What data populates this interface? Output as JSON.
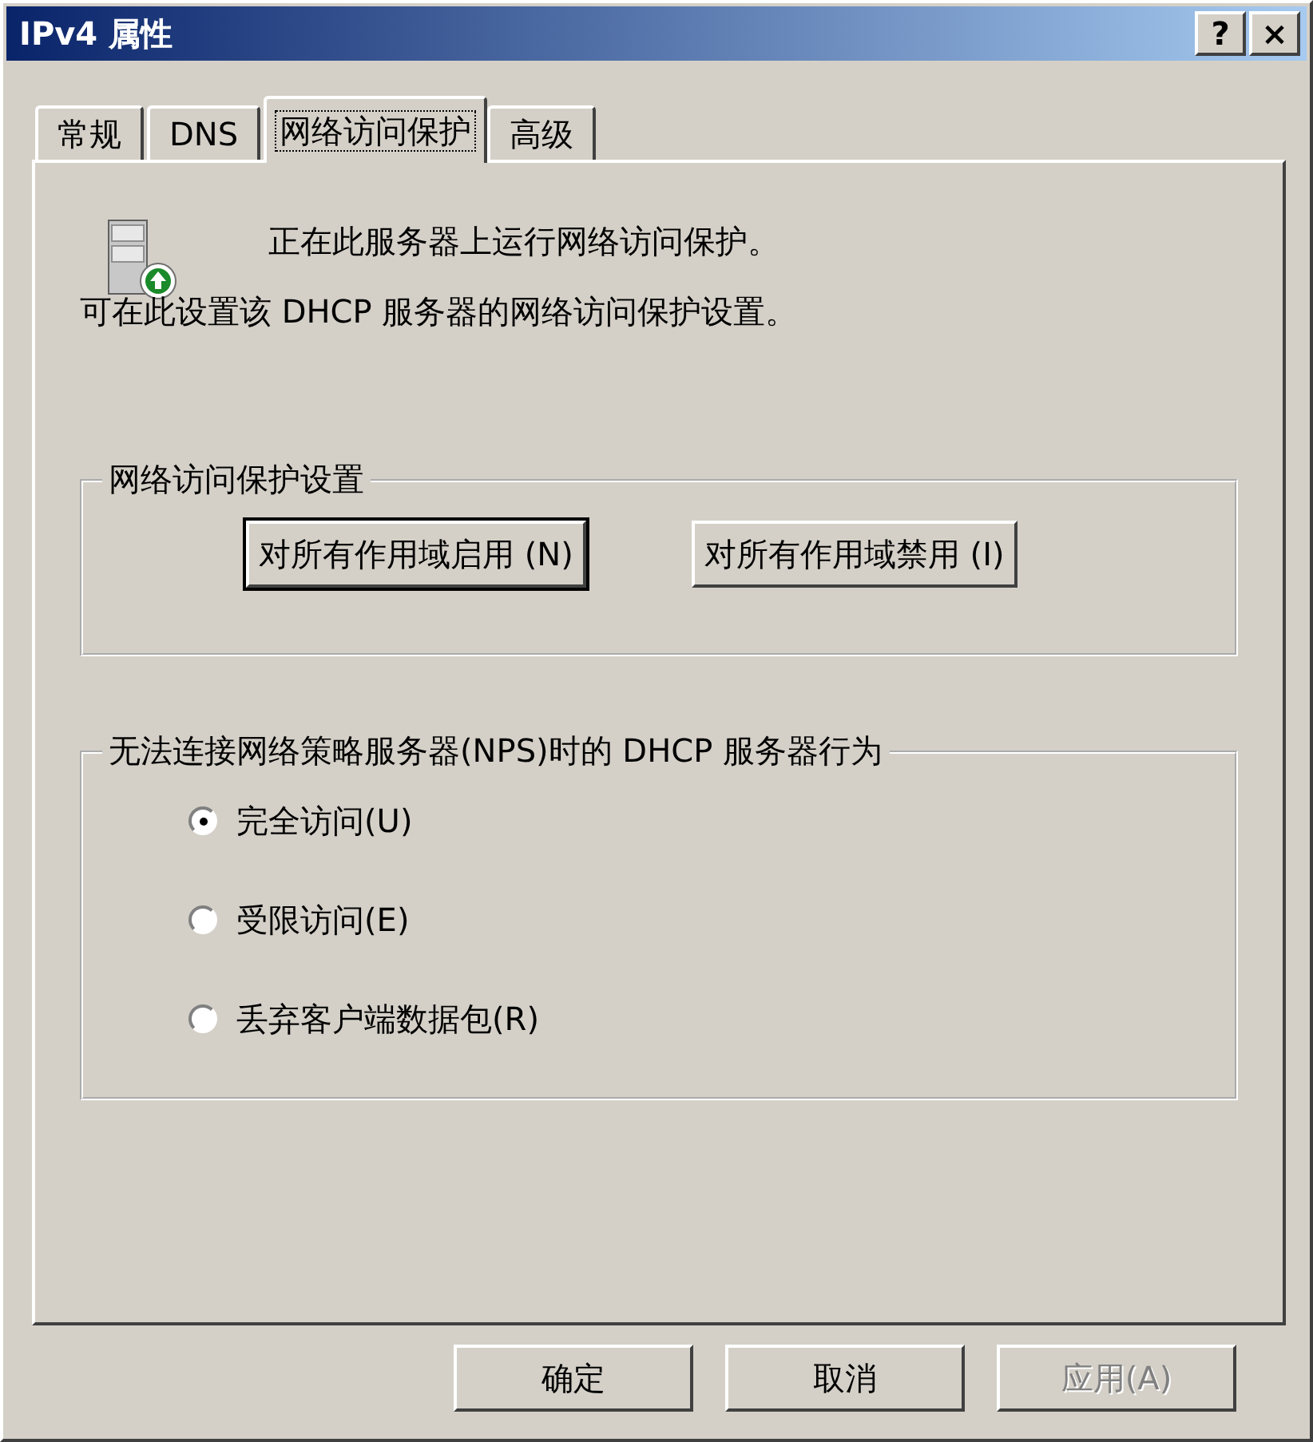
{
  "window": {
    "title": "IPv4 属性",
    "help_button": "?",
    "close_button": "×"
  },
  "tabs": [
    {
      "label": "常规",
      "selected": false
    },
    {
      "label": "DNS",
      "selected": false
    },
    {
      "label": "网络访问保护",
      "selected": true
    },
    {
      "label": "高级",
      "selected": false
    }
  ],
  "panel": {
    "status_text": "正在此服务器上运行网络访问保护。",
    "description": "可在此设置该 DHCP 服务器的网络访问保护设置。",
    "settings_group": {
      "legend": "网络访问保护设置",
      "buttons": [
        {
          "label": "对所有作用域启用 (N)",
          "default": true
        },
        {
          "label": "对所有作用域禁用 (I)",
          "default": false
        }
      ]
    },
    "behavior_group": {
      "legend": "无法连接网络策略服务器(NPS)时的 DHCP 服务器行为",
      "options": [
        {
          "label": "完全访问(U)",
          "selected": true
        },
        {
          "label": "受限访问(E)",
          "selected": false
        },
        {
          "label": "丢弃客户端数据包(R)",
          "selected": false
        }
      ]
    }
  },
  "buttons": [
    {
      "label": "确定",
      "disabled": false
    },
    {
      "label": "取消",
      "disabled": false
    },
    {
      "label": "应用(A)",
      "disabled": true
    }
  ]
}
